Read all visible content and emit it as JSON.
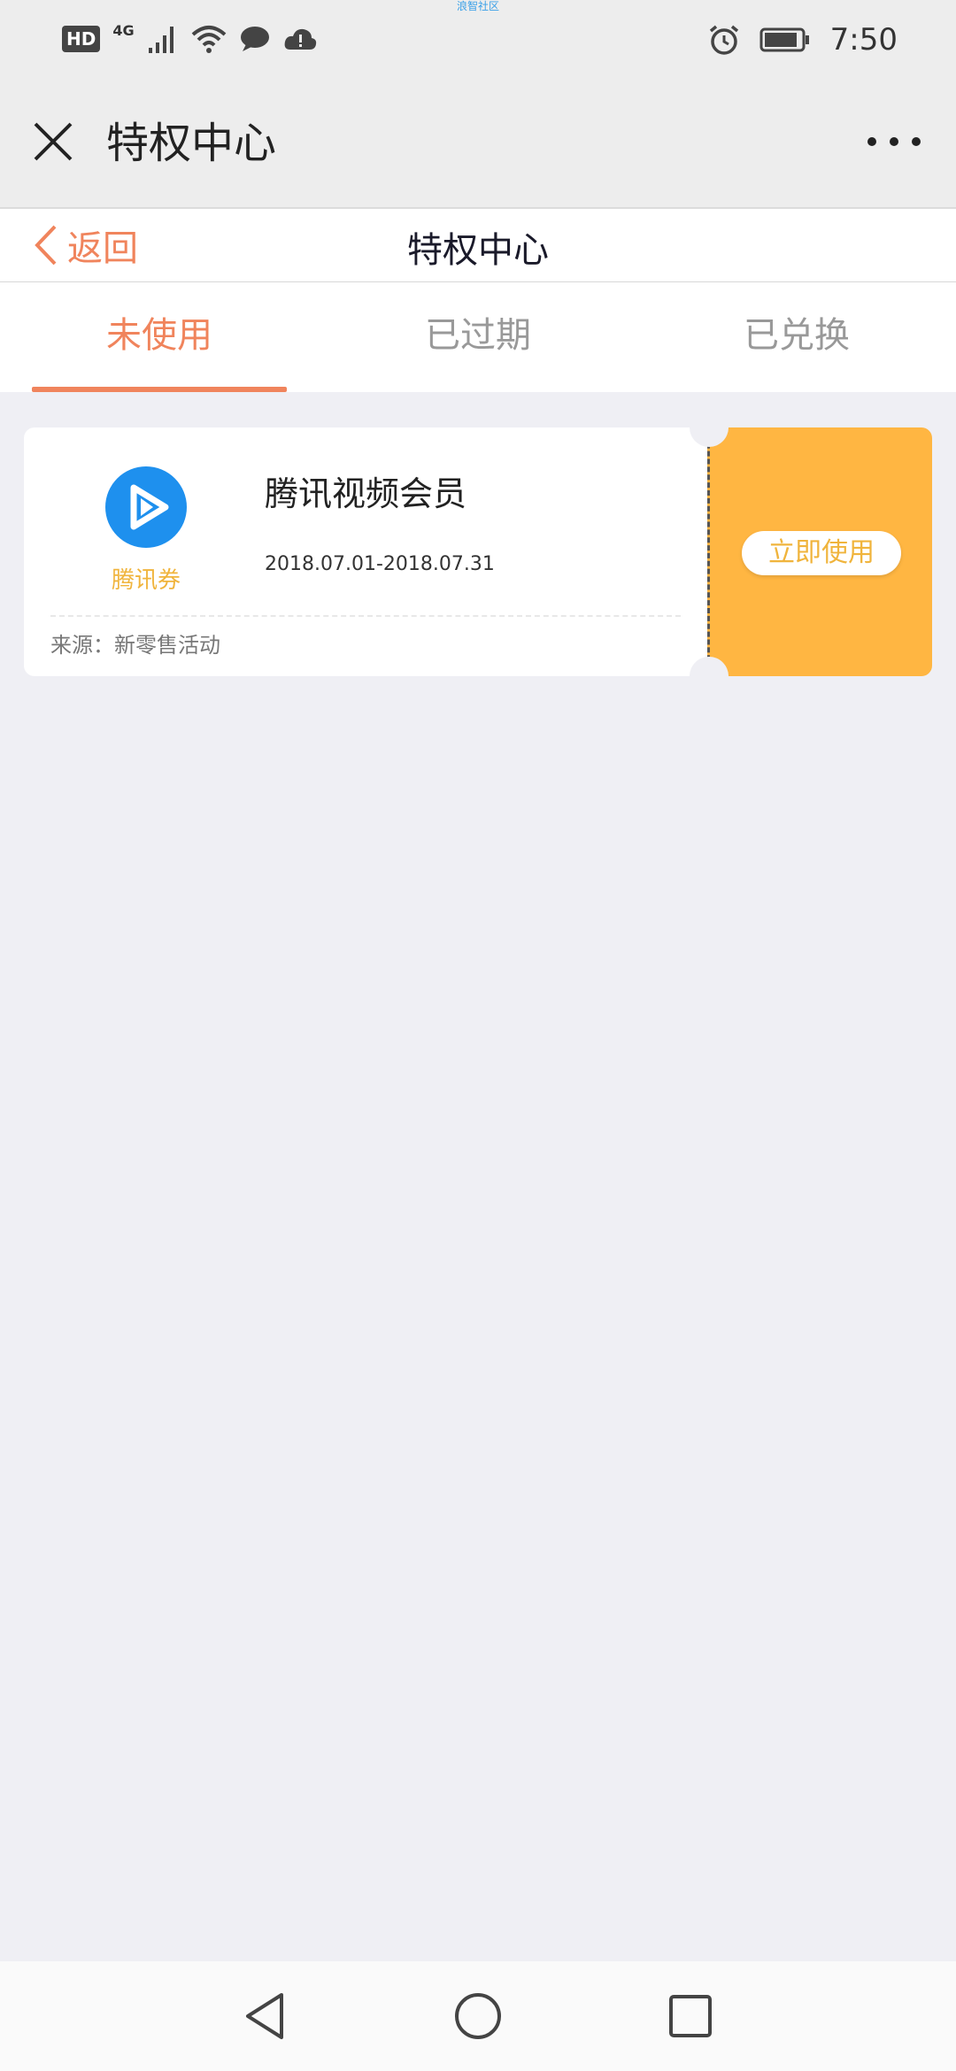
{
  "status_bar": {
    "hd_badge": "HD",
    "network": "4G",
    "time": "7:50",
    "carrier_tag": "浪智社区"
  },
  "titlebar": {
    "title": "特权中心",
    "close_icon": "close-icon",
    "more_icon": "more-icon"
  },
  "webnav": {
    "back_label": "返回",
    "title": "特权中心"
  },
  "tabs": [
    {
      "label": "未使用",
      "active": true
    },
    {
      "label": "已过期",
      "active": false
    },
    {
      "label": "已兑换",
      "active": false
    }
  ],
  "coupon": {
    "brand_caption": "腾讯券",
    "name": "腾讯视频会员",
    "date_range": "2018.07.01-2018.07.31",
    "source": "来源：新零售活动",
    "use_button_label": "立即使用"
  },
  "colors": {
    "accent": "#f0845c",
    "coupon_side": "#ffb642",
    "brand_blue": "#1e90ee",
    "caption_gold": "#f0b43c",
    "page_bg": "#efeff4"
  }
}
